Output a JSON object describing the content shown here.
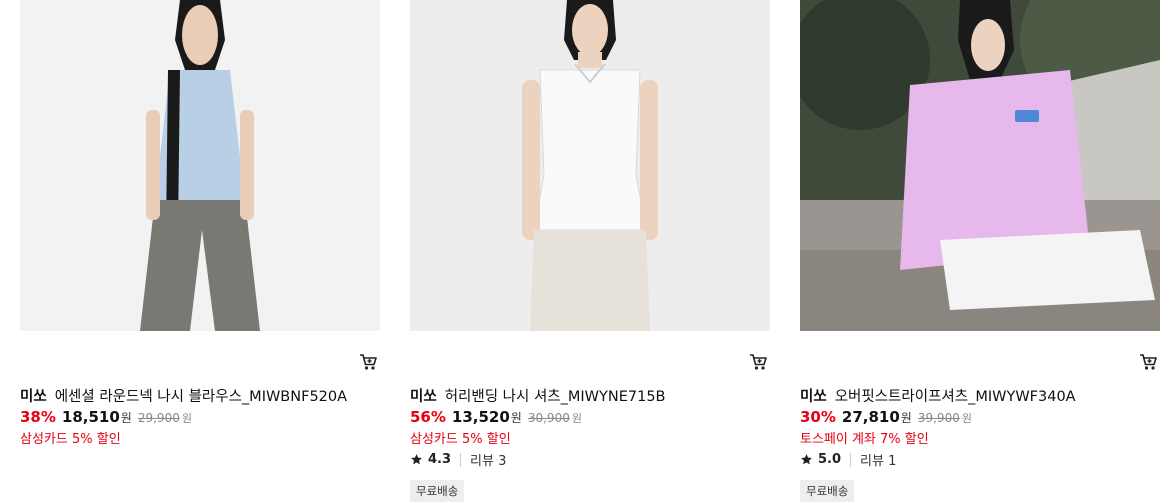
{
  "products": [
    {
      "brand": "미쏘",
      "name": "에센셜 라운드넥 나시 블라우스_MIWBNF520A",
      "discount_rate": "38%",
      "price": "18,510",
      "currency": "원",
      "original_price": "29,900",
      "promo": "삼성카드 5% 할인",
      "photo_colors": {
        "background": "#f2f2f2",
        "top": "#b8cfe6",
        "bottom": "#7a7873"
      }
    },
    {
      "brand": "미쏘",
      "name": "허리밴딩 나시 셔츠_MIWYNE715B",
      "discount_rate": "56%",
      "price": "13,520",
      "currency": "원",
      "original_price": "30,900",
      "promo": "삼성카드 5% 할인",
      "rating": "4.3",
      "review_label": "리뷰 3",
      "badge": "무료배송",
      "photo_colors": {
        "background": "#ededed",
        "top": "#fafafa",
        "bottom": "#e6e2da"
      }
    },
    {
      "brand": "미쏘",
      "name": "오버핏스트라이프셔츠_MIWYWF340A",
      "discount_rate": "30%",
      "price": "27,810",
      "currency": "원",
      "original_price": "39,900",
      "promo": "토스페이 계좌 7% 할인",
      "rating": "5.0",
      "review_label": "리뷰 1",
      "badge": "무료배송",
      "photo_colors": {
        "background": "#3f4a3a",
        "top": "#e6b8ec",
        "bottom": "#f4f4f4"
      }
    }
  ],
  "colors": {
    "discount": "#e60012",
    "badge_bg": "#eeeeee"
  }
}
